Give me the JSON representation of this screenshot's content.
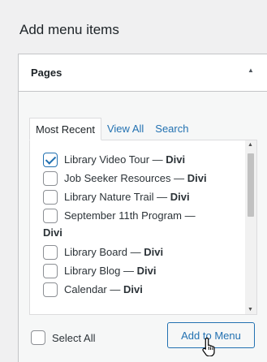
{
  "heading": "Add menu items",
  "panel": {
    "title": "Pages",
    "toggle_icon": "▲"
  },
  "tabs": [
    {
      "label": "Most Recent",
      "active": true
    },
    {
      "label": "View All",
      "active": false
    },
    {
      "label": "Search",
      "active": false
    }
  ],
  "items": [
    {
      "title": "Library Video Tour",
      "theme": "Divi",
      "checked": true
    },
    {
      "title": "Job Seeker Resources",
      "theme": "Divi",
      "checked": false
    },
    {
      "title": "Library Nature Trail",
      "theme": "Divi",
      "checked": false
    },
    {
      "title": "September 11th Program",
      "theme": "Divi",
      "checked": false
    },
    {
      "title": "Library Board",
      "theme": "Divi",
      "checked": false
    },
    {
      "title": "Library Blog",
      "theme": "Divi",
      "checked": false
    },
    {
      "title": "Calendar",
      "theme": "Divi",
      "checked": false
    }
  ],
  "separator": " — ",
  "select_all_label": "Select All",
  "add_button_label": "Add to Menu"
}
